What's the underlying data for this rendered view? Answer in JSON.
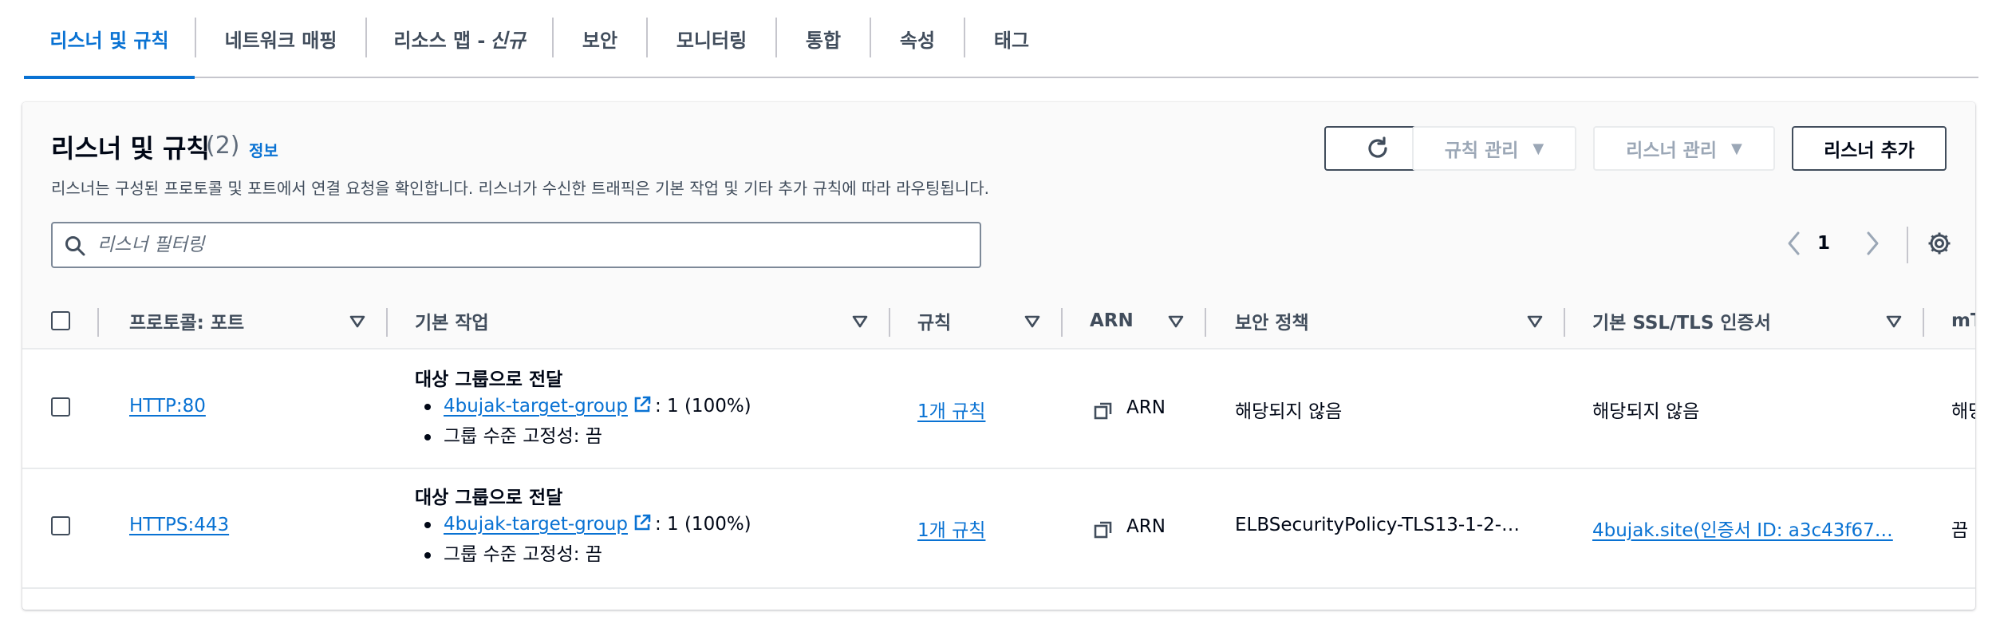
{
  "tabs": [
    {
      "label": "리스너 및 규칙",
      "active": true
    },
    {
      "label": "네트워크 매핑"
    },
    {
      "label": "리소스 맵 - "
    },
    {
      "label": "보안"
    },
    {
      "label": "모니터링"
    },
    {
      "label": "통합"
    },
    {
      "label": "속성"
    },
    {
      "label": "태그"
    }
  ],
  "tab_new_badge": "신규",
  "panel": {
    "title": "리스너 및 규칙",
    "count": "(2)",
    "info": "정보",
    "description": "리스너는 구성된 프로토콜 및 포트에서 연결 요청을 확인합니다. 리스너가 수신한 트래픽은 기본 작업 및 기타 추가 규칙에 따라 라우팅됩니다.",
    "buttons": {
      "refresh": "refresh",
      "manage_rules": "규칙 관리",
      "manage_listener": "리스너 관리",
      "add_listener": "리스너 추가"
    },
    "search_placeholder": "리스너 필터링",
    "page": "1"
  },
  "columns": {
    "protocol": "프로토콜: 포트",
    "default_action": "기본 작업",
    "rules": "규칙",
    "arn": "ARN",
    "security_policy": "보안 정책",
    "ssl_cert": "기본 SSL/TLS 인증서",
    "mtls": "mT"
  },
  "rows": [
    {
      "protocol": "HTTP:80",
      "action_title": "대상 그룹으로 전달",
      "target_group": "4bujak-target-group",
      "weight": ": 1 (100%)",
      "stickiness": "그룹 수준 고정성: 끔",
      "rules": "1개 규칙",
      "arn": "ARN",
      "security_policy": "해당되지 않음",
      "ssl_cert": "해당되지 않음",
      "ssl_cert_is_link": false,
      "mtls": "해당"
    },
    {
      "protocol": "HTTPS:443",
      "action_title": "대상 그룹으로 전달",
      "target_group": "4bujak-target-group",
      "weight": ": 1 (100%)",
      "stickiness": "그룹 수준 고정성: 끔",
      "rules": "1개 규칙",
      "arn": "ARN",
      "security_policy": "ELBSecurityPolicy-TLS13-1-2-…",
      "ssl_cert": "4bujak.site(인증서 ID: a3c43f67…",
      "ssl_cert_is_link": true,
      "mtls": "끔"
    }
  ],
  "colors": {
    "link": "#0972d3",
    "text": "#000716",
    "muted": "#414d5c",
    "header_bg": "#fafafa"
  }
}
